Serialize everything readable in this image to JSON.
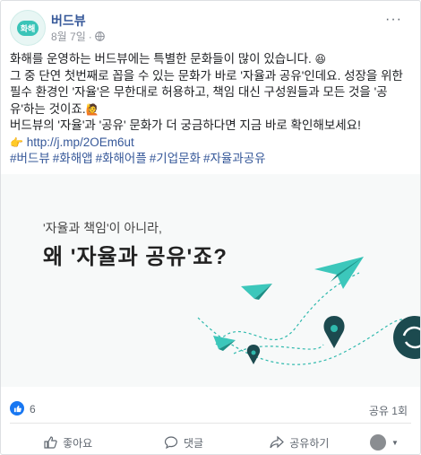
{
  "post": {
    "page_name": "버드뷰",
    "avatar_text": "화해",
    "date": "8월 7일",
    "more_label": "···",
    "line1": "화해를 운영하는 버드뷰에는 특별한 문화들이 많이 있습니다.",
    "line1_emoji": "😆",
    "line2": "그 중 단연 첫번째로 꼽을 수 있는 문화가 바로 '자율과 공유'인데요. 성장을 위한 필수 환경인 '자율'은 무한대로 허용하고, 책임 대신 구성원들과 모든 것을 '공유'하는 것이죠.",
    "line2_emoji": "🙋",
    "line3": "버드뷰의 '자율'과 '공유' 문화가 더 궁금하다면 지금 바로 확인해보세요!",
    "link_emoji": "👉",
    "link": "http://j.mp/2OEm6ut",
    "tags": [
      "#버드뷰",
      "#화해앱",
      "#화해어플",
      "#기업문화",
      "#자율과공유"
    ]
  },
  "banner": {
    "subtitle": "'자율과 책임'이 아니라,",
    "title": "왜 '자율과 공유'죠?",
    "accent_color": "#2fb9ad",
    "dark_color": "#1c4a4f"
  },
  "stats": {
    "likes": "6",
    "shares": "공유 1회"
  },
  "actions": {
    "like": "좋아요",
    "comment": "댓글",
    "share": "공유하기"
  }
}
